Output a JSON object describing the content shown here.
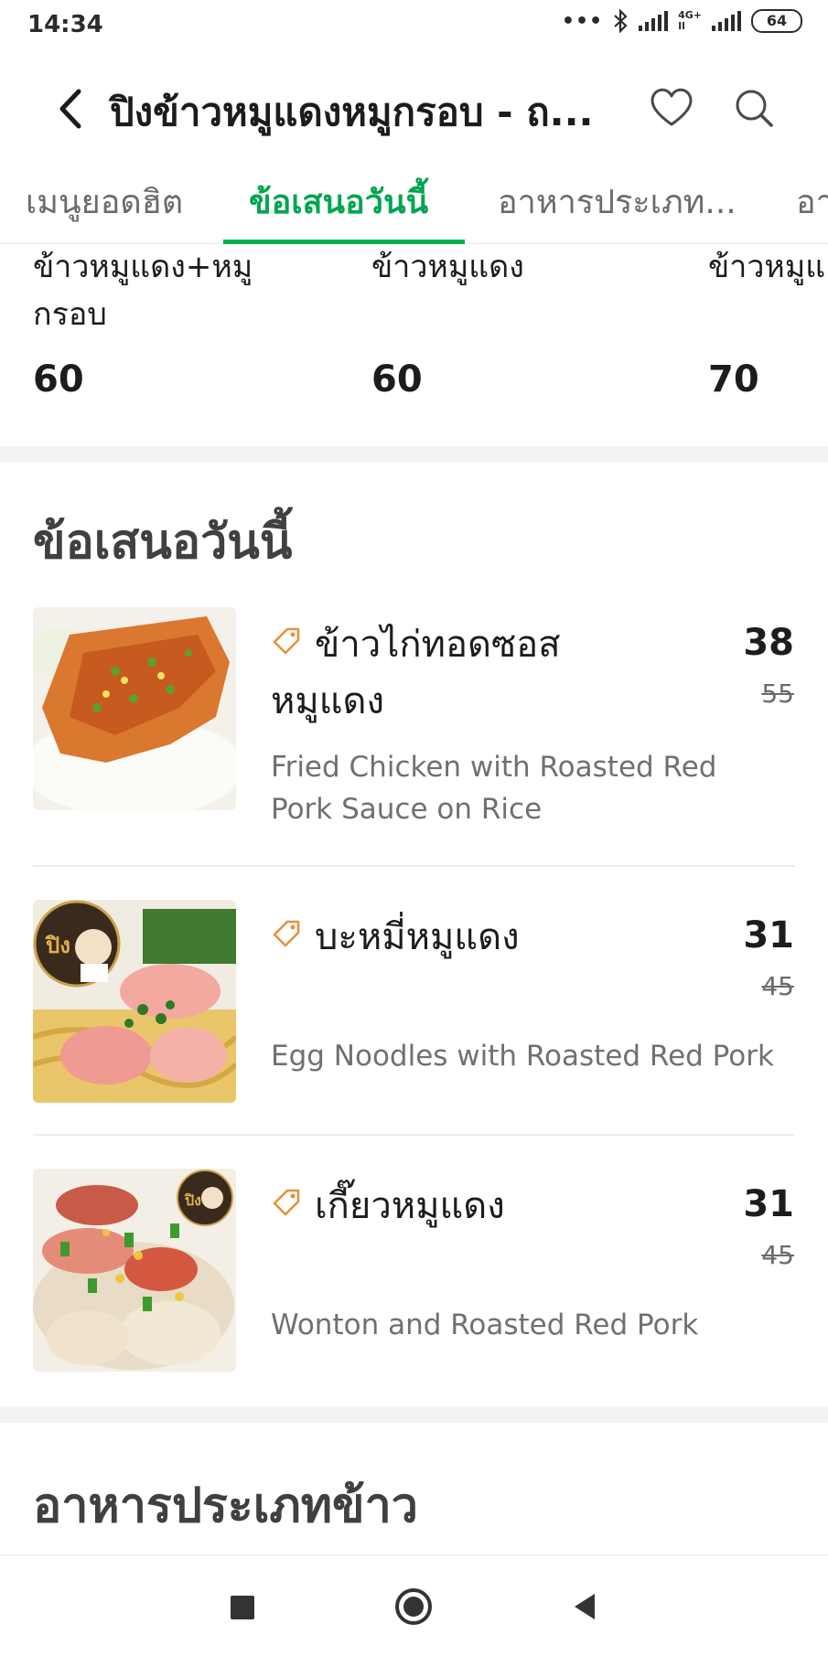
{
  "status": {
    "time": "14:34",
    "network_top": "4G+",
    "network_bottom": "Il",
    "battery": "64"
  },
  "header": {
    "title": "ปิงข้าวหมูแดงหมูกรอบ - ถ..."
  },
  "tabs": [
    {
      "label": "เมนูยอดฮิต"
    },
    {
      "label": "ข้อเสนอวันนี้"
    },
    {
      "label": "อาหารประเภท..."
    },
    {
      "label": "อา"
    }
  ],
  "popular": [
    {
      "name": "ข้าวหมูแดง+หมูกรอบ",
      "price": "60"
    },
    {
      "name": "ข้าวหมูแดง",
      "price": "60"
    },
    {
      "name": "ข้าวหมูแ",
      "price": "70"
    }
  ],
  "sections": {
    "deals_title": "ข้อเสนอวันนี้",
    "rice_title": "อาหารประเภทข้าว"
  },
  "deals": [
    {
      "name": "ข้าวไก่ทอดซอสหมูแดง",
      "price": "38",
      "original_price": "55",
      "description": "Fried Chicken with Roasted Red Pork Sauce on Rice"
    },
    {
      "name": "บะหมี่หมูแดง",
      "price": "31",
      "original_price": "45",
      "description": "Egg Noodles with Roasted Red Pork"
    },
    {
      "name": "เกี๊ยวหมูแดง",
      "price": "31",
      "original_price": "45",
      "description": "Wonton and Roasted Red Pork"
    }
  ],
  "badge": {
    "logo_text": "ปิง"
  },
  "colors": {
    "accent": "#00b14f",
    "promo": "#e8913a",
    "section_gap": "#f3f3f3"
  }
}
